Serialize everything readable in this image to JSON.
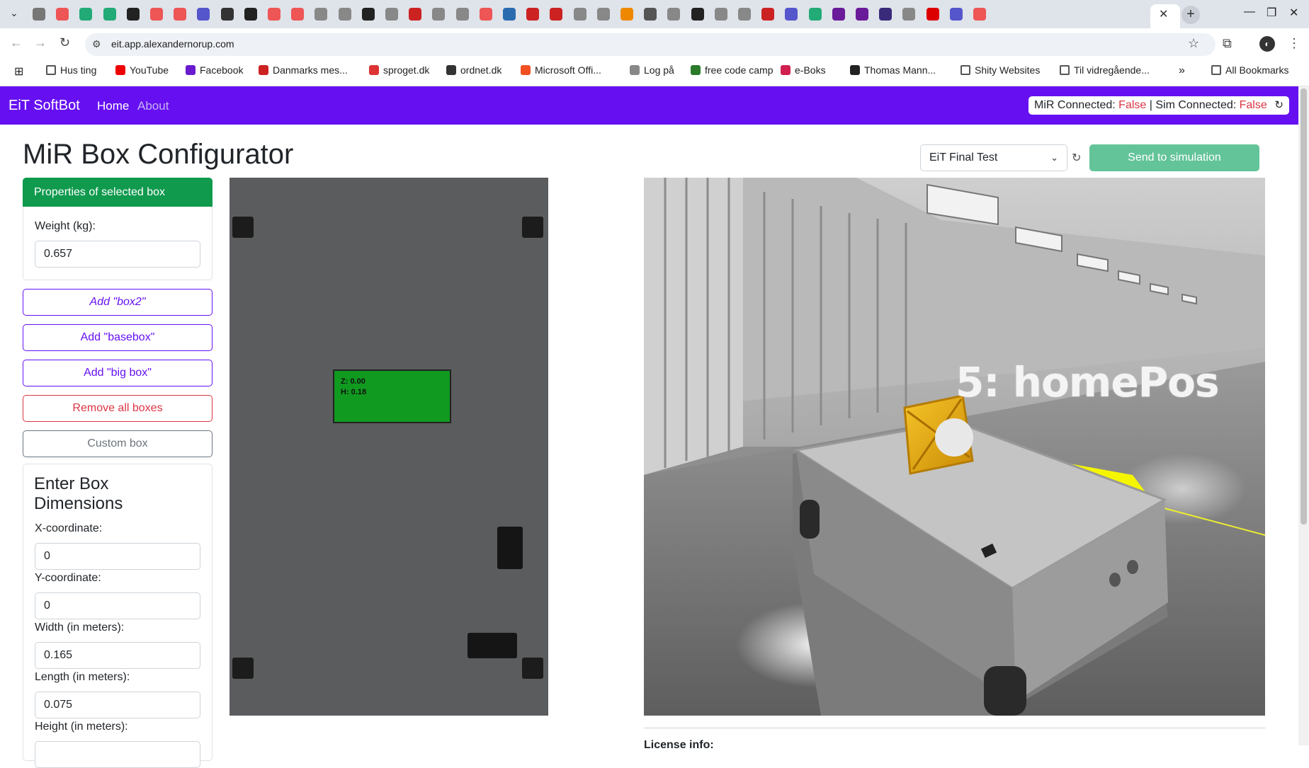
{
  "browser": {
    "url": "eit.app.alexandernorup.com",
    "tab_favicon_colors": [
      "#777",
      "#e55",
      "#2a7",
      "#2a7",
      "#222",
      "#e55",
      "#e55",
      "#55c",
      "#333",
      "#222",
      "#e55",
      "#e55",
      "#888",
      "#888",
      "#222",
      "#888",
      "#c22",
      "#888",
      "#888",
      "#e55",
      "#2a6bb0",
      "#c22",
      "#c22",
      "#888",
      "#888",
      "#e80",
      "#555",
      "#888",
      "#222",
      "#888",
      "#888",
      "#c22",
      "#55c",
      "#2a7",
      "#6a1b9a",
      "#6a1b9a",
      "#3a2a7a",
      "#888",
      "#d00",
      "#55c",
      "#e55"
    ],
    "bookmarks": [
      {
        "label": "Hus ting",
        "icon": "folder-icon",
        "color": "#555"
      },
      {
        "label": "YouTube",
        "icon": "youtube-icon",
        "color": "#e00"
      },
      {
        "label": "Facebook",
        "icon": "facebook-icon",
        "color": "#6a1bd0"
      },
      {
        "label": "Danmarks mes...",
        "icon": "site-icon",
        "color": "#c22"
      },
      {
        "label": "sproget.dk",
        "icon": "site-icon",
        "color": "#d33"
      },
      {
        "label": "ordnet.dk",
        "icon": "site-icon",
        "color": "#333"
      },
      {
        "label": "Microsoft Offi...",
        "icon": "microsoft-icon",
        "color": "#f25022"
      },
      {
        "label": "Log på",
        "icon": "globe-icon",
        "color": "#888"
      },
      {
        "label": "free code camp",
        "icon": "site-icon",
        "color": "#2a7a2a"
      },
      {
        "label": "e-Boks",
        "icon": "site-icon",
        "color": "#d02050"
      },
      {
        "label": "Thomas Mann...",
        "icon": "wikipedia-icon",
        "color": "#222"
      },
      {
        "label": "Shity Websites",
        "icon": "folder-icon",
        "color": "#555"
      },
      {
        "label": "Til vidregående...",
        "icon": "folder-icon",
        "color": "#555"
      }
    ],
    "more_bookmarks": "»",
    "all_bookmarks": "All Bookmarks"
  },
  "app": {
    "brand": "EiT SoftBot",
    "nav": [
      {
        "label": "Home",
        "active": true
      },
      {
        "label": "About",
        "active": false
      }
    ],
    "status": {
      "mir_label": "MiR Connected: ",
      "mir_value": "False",
      "separator": " | ",
      "sim_label": "Sim Connected: ",
      "sim_value": "False"
    },
    "page_title": "MiR Box Configurator",
    "simulation": {
      "selected": "EiT Final Test",
      "send_label": "Send to simulation"
    },
    "properties": {
      "header": "Properties of selected box",
      "weight_label": "Weight (kg):",
      "weight_value": "0.657"
    },
    "buttons": {
      "add_box2": "Add \"box2\"",
      "add_basebox": "Add \"basebox\"",
      "add_bigbox": "Add \"big box\"",
      "remove_all": "Remove all boxes",
      "custom_box": "Custom box"
    },
    "dimensions": {
      "title": "Enter Box Dimensions",
      "x_label": "X-coordinate:",
      "x_value": "0",
      "y_label": "Y-coordinate:",
      "y_value": "0",
      "width_label": "Width (in meters):",
      "width_value": "0.165",
      "length_label": "Length (in meters):",
      "length_value": "0.075",
      "height_label": "Height (in meters):"
    },
    "topview": {
      "selected_box_z": "Z: 0.00",
      "selected_box_h": "H: 0.18"
    },
    "view3d": {
      "waypoint_label": "5: homePos"
    },
    "license_label": "License info:",
    "colors": {
      "navbar": "#6610f2",
      "success_header": "#109a4e",
      "danger": "#dc3545",
      "send_button": "#63c49a"
    }
  }
}
